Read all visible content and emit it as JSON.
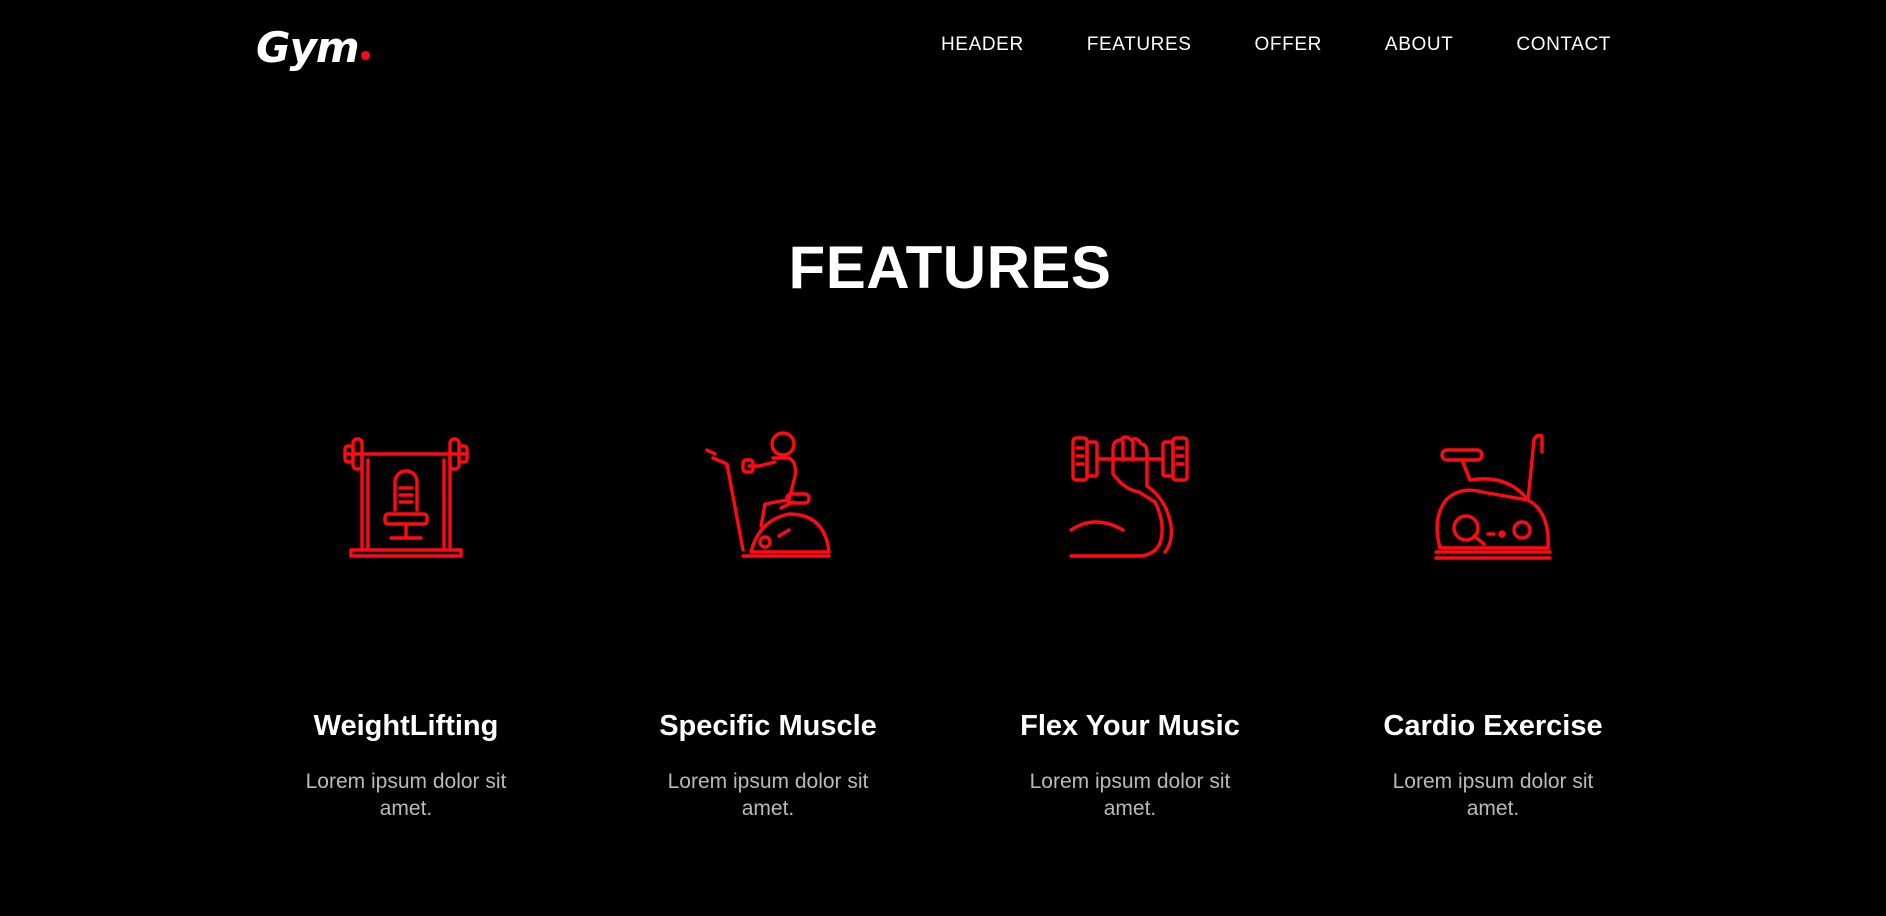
{
  "header": {
    "logo": "Gym",
    "nav": [
      "HEADER",
      "FEATURES",
      "OFFER",
      "ABOUT",
      "CONTACT"
    ]
  },
  "features_section": {
    "title": "FEATURES",
    "items": [
      {
        "title": "WeightLifting",
        "description": "Lorem ipsum dolor sit amet.",
        "icon": "weight-bench-icon"
      },
      {
        "title": "Specific Muscle",
        "description": "Lorem ipsum dolor sit amet.",
        "icon": "rowing-machine-icon"
      },
      {
        "title": "Flex Your Music",
        "description": "Lorem ipsum dolor sit amet.",
        "icon": "dumbbell-arm-icon"
      },
      {
        "title": "Cardio Exercise",
        "description": "Lorem ipsum dolor sit amet.",
        "icon": "exercise-bike-icon"
      }
    ]
  },
  "colors": {
    "background": "#000000",
    "accent": "#ff0a14",
    "text": "#ffffff",
    "muted_text": "#b9b9b9"
  }
}
